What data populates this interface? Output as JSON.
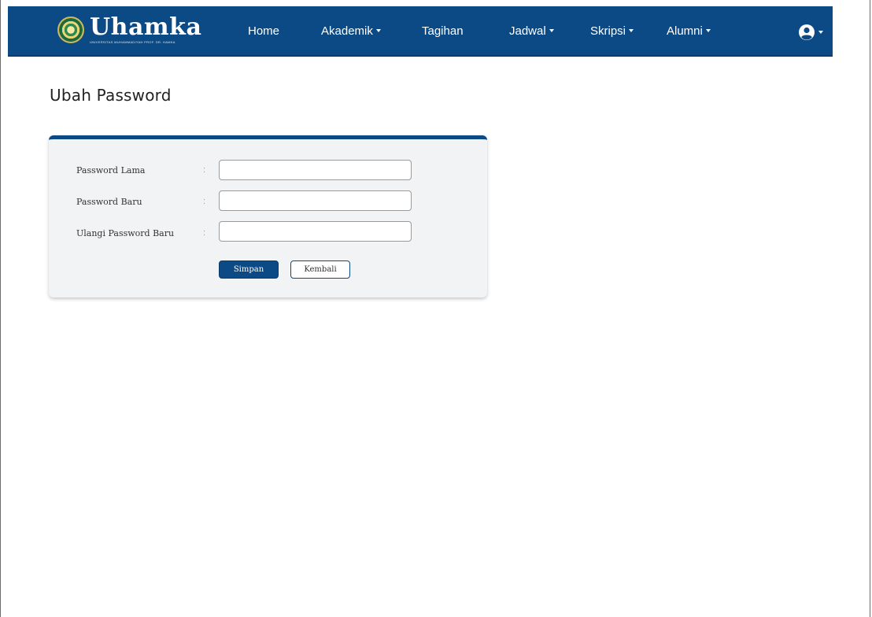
{
  "brand": {
    "name": "Uhamka",
    "tagline": "UNIVERSITAS MUHAMMADIYAH PROF. DR. HAMKA"
  },
  "nav": {
    "items": [
      {
        "label": "Home",
        "dropdown": false
      },
      {
        "label": "Akademik",
        "dropdown": true
      },
      {
        "label": "Tagihan",
        "dropdown": false
      },
      {
        "label": "Jadwal",
        "dropdown": true
      },
      {
        "label": "Skripsi",
        "dropdown": true
      },
      {
        "label": "Alumni",
        "dropdown": true
      }
    ],
    "user_icon": "user-circle-icon"
  },
  "page": {
    "title": "Ubah Password"
  },
  "form": {
    "fields": [
      {
        "label": "Password Lama",
        "separator": ":",
        "value": "",
        "placeholder": ""
      },
      {
        "label": "Password Baru",
        "separator": ":",
        "value": "",
        "placeholder": ""
      },
      {
        "label": "Ulangi Password Baru",
        "separator": ":",
        "value": "",
        "placeholder": ""
      }
    ],
    "submit_label": "Simpan",
    "back_label": "Kembali"
  },
  "colors": {
    "primary": "#0c4a86",
    "card_background": "#f2f3f4",
    "page_background": "#ffffff"
  }
}
